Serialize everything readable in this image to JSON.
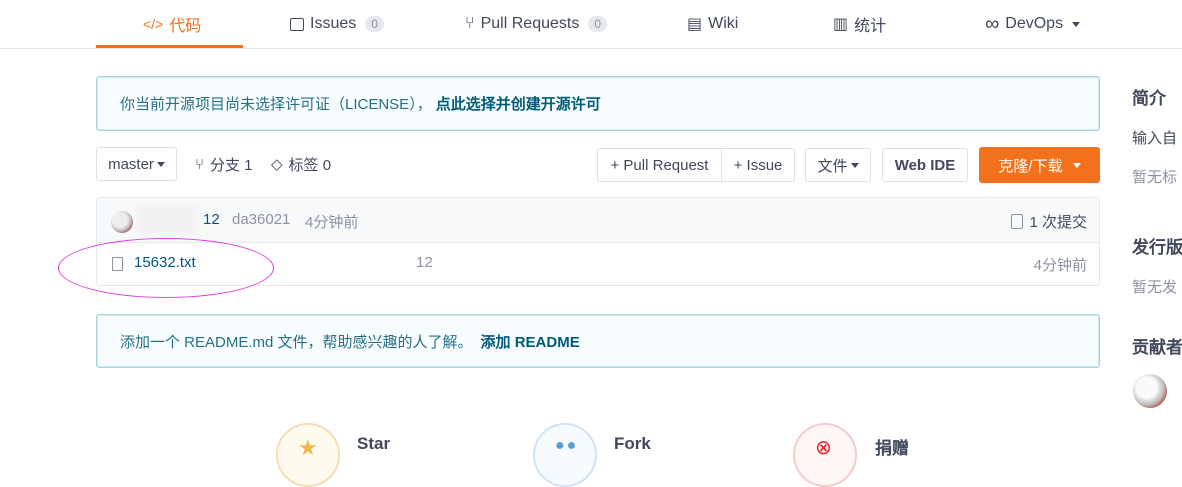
{
  "tabs": [
    {
      "icon": "code-icon",
      "glyph": "</>",
      "label": "代码",
      "active": true
    },
    {
      "icon": "issues-icon",
      "glyph": "☐",
      "label": "Issues",
      "count": "0"
    },
    {
      "icon": "pull-request-icon",
      "glyph": "⑂",
      "label": "Pull Requests",
      "count": "0"
    },
    {
      "icon": "wiki-icon",
      "glyph": "▤",
      "label": "Wiki"
    },
    {
      "icon": "stats-icon",
      "glyph": "▥",
      "label": "统计"
    },
    {
      "icon": "devops-icon",
      "glyph": "∞",
      "label": "DevOps"
    }
  ],
  "license_notice": {
    "text": "你当前开源项目尚未选择许可证（LICENSE），",
    "link": "点此选择并创建开源许可"
  },
  "toolbar": {
    "branch": "master",
    "branches_label": "分支 1",
    "tags_label": "标签 0",
    "new_pr": "+ Pull Request",
    "new_issue": "+ Issue",
    "files_menu": "文件",
    "web_ide": "Web IDE",
    "clone": "克隆/下载"
  },
  "commit": {
    "message": "12",
    "hash": "da36021",
    "time": "4分钟前",
    "count_label": "1 次提交"
  },
  "files": [
    {
      "name": "15632.txt",
      "message": "12",
      "time": "4分钟前"
    }
  ],
  "readme_notice": {
    "text": "添加一个 README.md 文件，帮助感兴趣的人了解。",
    "link": "添加 README"
  },
  "actions": [
    {
      "label": "Star",
      "icon": "star-icon",
      "color": "#f2b84b"
    },
    {
      "label": "Fork",
      "icon": "fork-icon",
      "color": "#5aa0d8"
    },
    {
      "label": "捐赠",
      "icon": "donate-icon",
      "color": "#db2828"
    }
  ],
  "sidebar": {
    "intro_title": "简介",
    "intro_text": "输入自",
    "intro_tags": "暂无标",
    "releases_title": "发行版",
    "releases_text": "暂无发",
    "contributors_title": "贡献者"
  },
  "colors": {
    "accent": "#f2711c",
    "link": "#005980",
    "notice_border": "#a9d5de"
  }
}
